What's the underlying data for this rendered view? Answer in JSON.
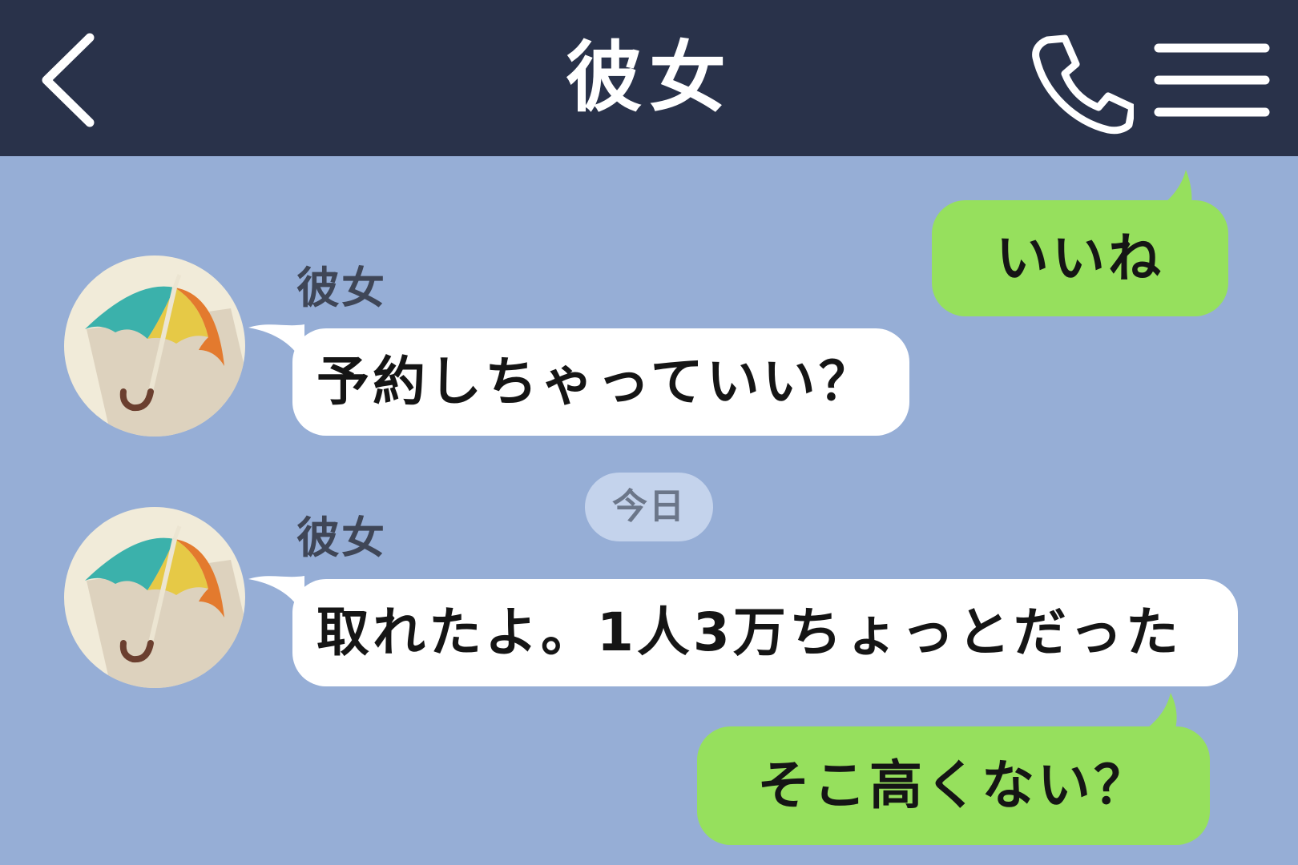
{
  "header": {
    "title": "彼女",
    "background": "#29324a",
    "back_icon": "chevron-left-icon",
    "call_icon": "phone-icon",
    "menu_icon": "hamburger-menu-icon"
  },
  "chat": {
    "background": "#96aed6",
    "messages": [
      {
        "direction": "outgoing",
        "text": "いいね"
      },
      {
        "direction": "incoming",
        "sender": "彼女",
        "avatar_icon": "umbrella-icon",
        "text": "予約しちゃっていい？"
      },
      {
        "type": "date-separator",
        "text": "今日"
      },
      {
        "direction": "incoming",
        "sender": "彼女",
        "avatar_icon": "umbrella-icon",
        "text": "取れたよ。1人3万ちょっとだった"
      },
      {
        "direction": "outgoing",
        "text": "そこ高くない？"
      }
    ]
  },
  "colors": {
    "incoming_bubble": "#ffffff",
    "outgoing_bubble": "#96e05d",
    "date_pill": "#c4d3ec"
  }
}
